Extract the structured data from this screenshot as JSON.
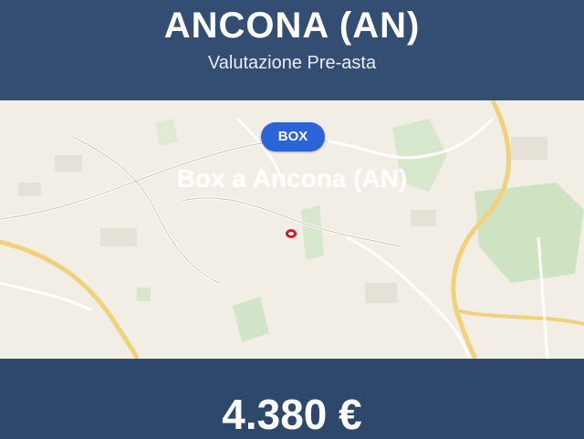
{
  "header": {
    "title": "ANCONA (AN)",
    "subtitle": "Valutazione Pre-asta"
  },
  "map": {
    "badge_label": "BOX",
    "caption": "Box a Ancona (AN)",
    "pin": "location-marker-icon"
  },
  "footer": {
    "price": "4.380 €"
  },
  "colors": {
    "header_bg": "#344d72",
    "badge_bg": "#2b63d9",
    "pin": "#d11a2a"
  }
}
